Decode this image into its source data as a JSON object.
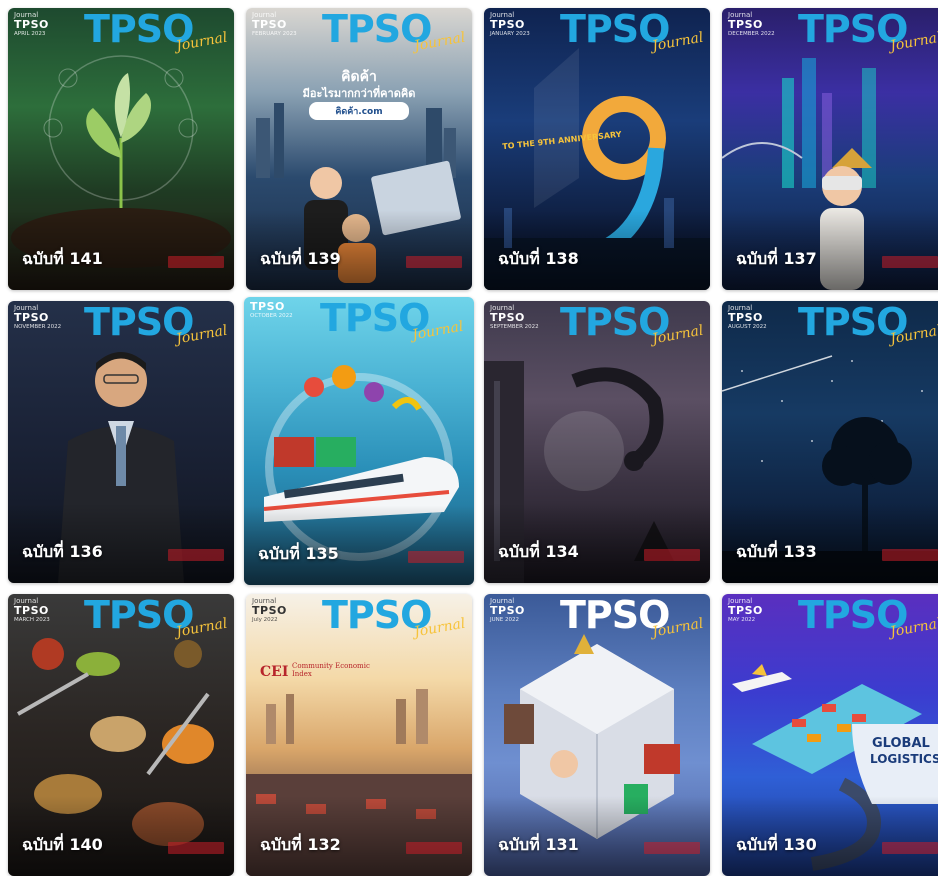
{
  "logo": {
    "text": "TPSO",
    "script": "Journal",
    "mini_label": "Journal"
  },
  "cards": [
    {
      "title": "ฉบับที่ 141",
      "date": "APRIL 2023"
    },
    {
      "title": "ฉบับที่ 139",
      "date": "FEBRUARY 2023",
      "headline": "คิดค้า",
      "subhead": "มีอะไรมากกว่าที่คาดคิด",
      "site": "คิดค้า.com"
    },
    {
      "title": "ฉบับที่ 138",
      "date": "JANUARY 2023",
      "anniv": "TO THE 9TH ANNIVERSARY"
    },
    {
      "title": "ฉบับที่ 137",
      "date": "DECEMBER 2022"
    },
    {
      "title": "ฉบับที่ 136",
      "date": "NOVEMBER 2022"
    },
    {
      "title": "ฉบับที่ 135",
      "date": "OCTOBER 2022"
    },
    {
      "title": "ฉบับที่ 134",
      "date": "SEPTEMBER 2022"
    },
    {
      "title": "ฉบับที่ 133",
      "date": "AUGUST 2022"
    },
    {
      "title": "ฉบับที่ 140",
      "date": "MARCH 2023"
    },
    {
      "title": "ฉบับที่ 132",
      "date": "July 2022",
      "cei": "CEI",
      "cei_sub": "Community Economic Index"
    },
    {
      "title": "ฉบับที่ 131",
      "date": "JUNE 2022"
    },
    {
      "title": "ฉบับที่ 130",
      "date": "MAY 2022",
      "global": "GLOBAL",
      "logistics": "LOGISTICS"
    }
  ],
  "colors": {
    "logo_blue": "#22a7e0",
    "script_gold": "#f6c33b"
  }
}
